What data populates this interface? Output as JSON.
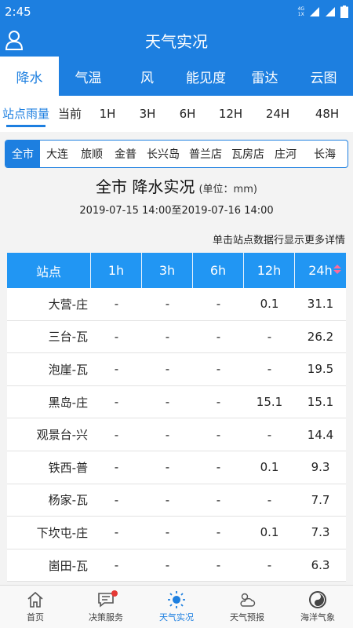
{
  "status": {
    "time": "2:45",
    "net_top": "4G",
    "net_bottom": "1X"
  },
  "header": {
    "title": "天气实况"
  },
  "tabs": [
    {
      "label": "降水"
    },
    {
      "label": "气温"
    },
    {
      "label": "风"
    },
    {
      "label": "能见度"
    },
    {
      "label": "雷达"
    },
    {
      "label": "云图"
    }
  ],
  "intervals": [
    {
      "label": "站点雨量"
    },
    {
      "label": "当前"
    },
    {
      "label": "1H"
    },
    {
      "label": "3H"
    },
    {
      "label": "6H"
    },
    {
      "label": "12H"
    },
    {
      "label": "24H"
    },
    {
      "label": "48H"
    }
  ],
  "filters": [
    {
      "label": "全市"
    },
    {
      "label": "大连"
    },
    {
      "label": "旅顺"
    },
    {
      "label": "金普"
    },
    {
      "label": "长兴岛"
    },
    {
      "label": "普兰店"
    },
    {
      "label": "瓦房店"
    },
    {
      "label": "庄河"
    },
    {
      "label": "长海"
    }
  ],
  "summary": {
    "title": "全市 降水实况",
    "unit": "(单位：mm)",
    "range": "2019-07-15 14:00至2019-07-16 14:00",
    "hint": "单击站点数据行显示更多详情"
  },
  "table": {
    "headers": [
      "站点",
      "1h",
      "3h",
      "6h",
      "12h",
      "24h"
    ],
    "rows": [
      [
        "大营-庄",
        "-",
        "-",
        "-",
        "0.1",
        "31.1"
      ],
      [
        "三台-瓦",
        "-",
        "-",
        "-",
        "-",
        "26.2"
      ],
      [
        "泡崖-瓦",
        "-",
        "-",
        "-",
        "-",
        "19.5"
      ],
      [
        "黑岛-庄",
        "-",
        "-",
        "-",
        "15.1",
        "15.1"
      ],
      [
        "观景台-兴",
        "-",
        "-",
        "-",
        "-",
        "14.4"
      ],
      [
        "铁西-普",
        "-",
        "-",
        "-",
        "0.1",
        "9.3"
      ],
      [
        "杨家-瓦",
        "-",
        "-",
        "-",
        "-",
        "7.7"
      ],
      [
        "下坎屯-庄",
        "-",
        "-",
        "-",
        "0.1",
        "7.3"
      ],
      [
        "崮田-瓦",
        "-",
        "-",
        "-",
        "-",
        "6.3"
      ]
    ]
  },
  "nav": [
    {
      "label": "首页",
      "icon": "home-icon"
    },
    {
      "label": "决策服务",
      "icon": "message-icon"
    },
    {
      "label": "天气实况",
      "icon": "sun-icon"
    },
    {
      "label": "天气预报",
      "icon": "cloud-sun-icon"
    },
    {
      "label": "海洋气象",
      "icon": "ocean-icon"
    }
  ],
  "colors": {
    "primary": "#1d7fe0",
    "table_header": "#2196f3",
    "sort_arrow": "#ff6b9c",
    "badge": "#e53935"
  }
}
